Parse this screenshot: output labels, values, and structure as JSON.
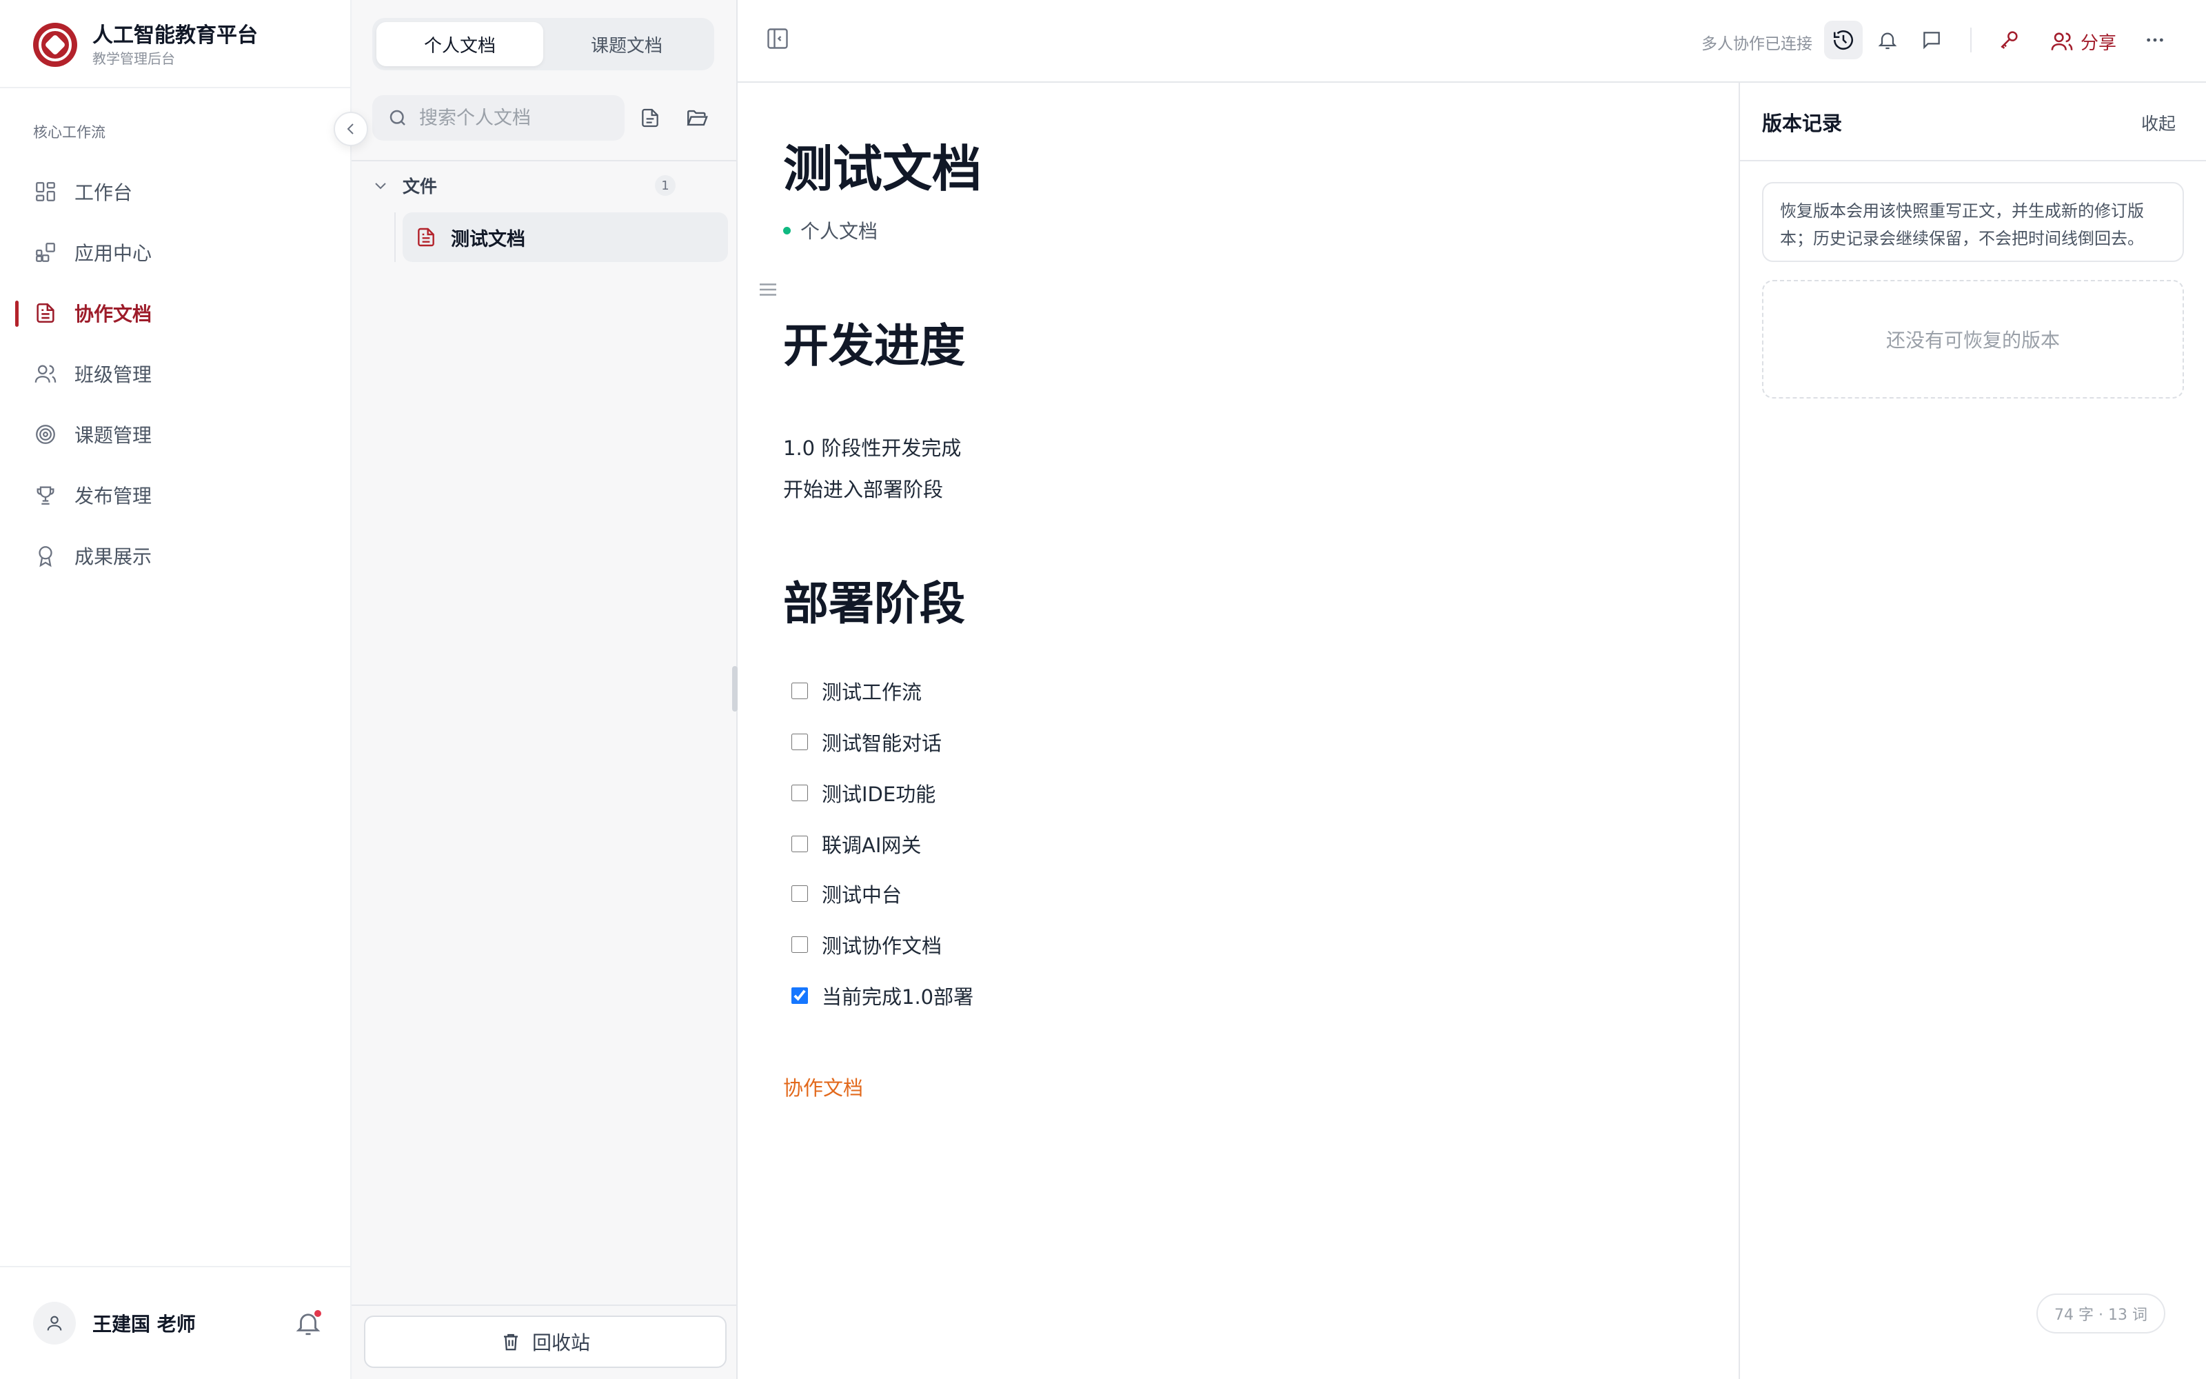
{
  "brand": {
    "title": "人工智能教育平台",
    "subtitle": "教学管理后台"
  },
  "sidebar": {
    "section_label": "核心工作流",
    "items": [
      {
        "label": "工作台",
        "icon": "grid-icon"
      },
      {
        "label": "应用中心",
        "icon": "apps-icon"
      },
      {
        "label": "协作文档",
        "icon": "document-icon",
        "active": true
      },
      {
        "label": "班级管理",
        "icon": "users-icon"
      },
      {
        "label": "课题管理",
        "icon": "target-icon"
      },
      {
        "label": "发布管理",
        "icon": "trophy-icon"
      },
      {
        "label": "成果展示",
        "icon": "award-icon"
      }
    ],
    "user": {
      "name": "王建国 老师"
    }
  },
  "tree": {
    "tabs": [
      {
        "label": "个人文档",
        "active": true
      },
      {
        "label": "课题文档",
        "active": false
      }
    ],
    "search_placeholder": "搜索个人文档",
    "folder": {
      "name": "文件",
      "count": "1"
    },
    "documents": [
      {
        "name": "测试文档"
      }
    ],
    "trash_label": "回收站"
  },
  "toolbar": {
    "collab_status": "多人协作已连接",
    "share_label": "分享"
  },
  "document": {
    "title": "测试文档",
    "meta": "个人文档",
    "sections": [
      {
        "heading": "开发进度",
        "paragraphs": [
          "1.0 阶段性开发完成",
          "开始进入部署阶段"
        ]
      },
      {
        "heading": "部署阶段"
      }
    ],
    "tasks": [
      {
        "label": "测试工作流",
        "checked": false
      },
      {
        "label": "测试智能对话",
        "checked": false
      },
      {
        "label": "测试IDE功能",
        "checked": false
      },
      {
        "label": "联调AI网关",
        "checked": false
      },
      {
        "label": "测试中台",
        "checked": false
      },
      {
        "label": "测试协作文档",
        "checked": false
      },
      {
        "label": "当前完成1.0部署",
        "checked": true
      }
    ],
    "link": "协作文档"
  },
  "versions": {
    "title": "版本记录",
    "collapse_label": "收起",
    "note": "恢复版本会用该快照重写正文，并生成新的修订版本；历史记录会继续保留，不会把时间线倒回去。",
    "empty": "还没有可恢复的版本",
    "word_count": "74 字 · 13 词"
  },
  "colors": {
    "brand": "#b3222b",
    "active_text": "#9d1c2a",
    "link": "#e2691c",
    "online_dot": "#10b981",
    "checkbox": "#1677ff"
  }
}
